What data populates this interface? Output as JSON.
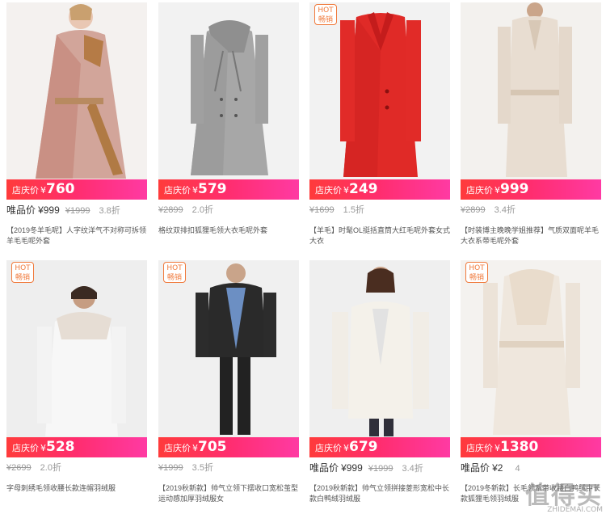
{
  "products": [
    {
      "hot": false,
      "price_label": "店庆价",
      "currency": "¥",
      "price": "760",
      "vip_label": "唯品价",
      "vip_price": "¥999",
      "orig_price": "¥1999",
      "discount": "3.8折",
      "title": "【2019冬羊毛呢】人字纹洋气不对称可拆领羊毛毛呢外套"
    },
    {
      "hot": false,
      "price_label": "店庆价",
      "currency": "¥",
      "price": "579",
      "vip_label": "",
      "vip_price": "",
      "orig_price": "¥2899",
      "discount": "2.0折",
      "title": "格纹双排扣狐狸毛领大衣毛呢外套"
    },
    {
      "hot": true,
      "price_label": "店庆价",
      "currency": "¥",
      "price": "249",
      "vip_label": "",
      "vip_price": "",
      "orig_price": "¥1699",
      "discount": "1.5折",
      "title": "【羊毛】时髦OL挺括直筒大红毛呢外套女式大衣"
    },
    {
      "hot": false,
      "price_label": "店庆价",
      "currency": "¥",
      "price": "999",
      "vip_label": "",
      "vip_price": "",
      "orig_price": "¥2899",
      "discount": "3.4折",
      "title": "【时装博主晚晚学姐推荐】气质双面呢羊毛大衣系带毛呢外套"
    },
    {
      "hot": true,
      "price_label": "店庆价",
      "currency": "¥",
      "price": "528",
      "vip_label": "",
      "vip_price": "",
      "orig_price": "¥2699",
      "discount": "2.0折",
      "title": "字母刺绣毛领收腰长款连帽羽绒服"
    },
    {
      "hot": true,
      "price_label": "店庆价",
      "currency": "¥",
      "price": "705",
      "vip_label": "",
      "vip_price": "",
      "orig_price": "¥1999",
      "discount": "3.5折",
      "title": "【2019秋新款】帅气立领下摆收口宽松茧型运动感加厚羽绒服女"
    },
    {
      "hot": false,
      "price_label": "店庆价",
      "currency": "¥",
      "price": "679",
      "vip_label": "唯品价",
      "vip_price": "¥999",
      "orig_price": "¥1999",
      "discount": "3.4折",
      "title": "【2019秋新款】帅气立领拼接菱形宽松中长款白鸭绒羽绒服"
    },
    {
      "hot": true,
      "price_label": "店庆价",
      "currency": "¥",
      "price": "1380",
      "vip_label": "唯品价",
      "vip_price": "¥2",
      "orig_price": "",
      "discount": "4",
      "title": "【2019冬新款】长毛领系带收腰白鸭绒中长款狐狸毛领羽绒服"
    }
  ],
  "hot_badge": {
    "line1": "HOT",
    "line2": "畅销"
  },
  "watermark": {
    "main": "值得买",
    "sub": "ZHIDEMAI.COM"
  },
  "colors": {
    "price_gradient_start": "#ff3b3b",
    "price_gradient_end": "#ff3aa3",
    "hot": "#f07a3c"
  }
}
